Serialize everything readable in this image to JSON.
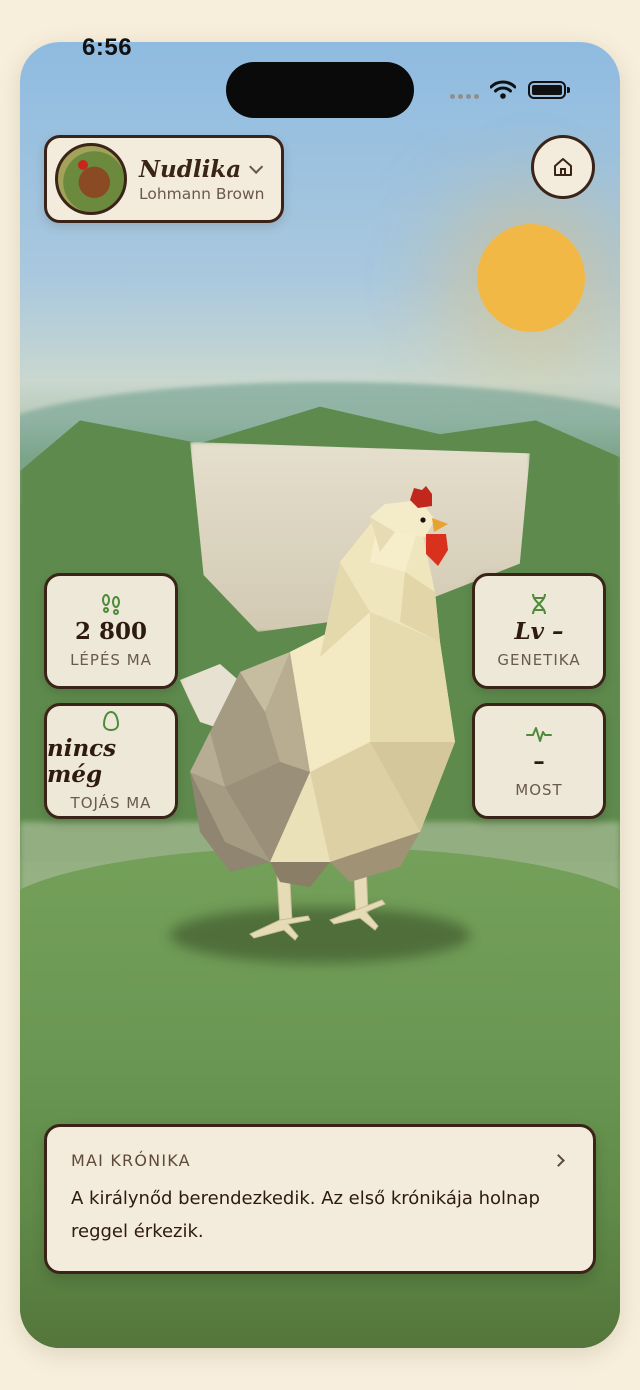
{
  "status_bar": {
    "time": "6:56"
  },
  "profile": {
    "name": "Nudlika",
    "breed": "Lohmann Brown"
  },
  "stats": [
    {
      "icon": "footprints-icon",
      "value": "2 800",
      "label": "LÉPÉS MA"
    },
    {
      "icon": "dna-icon",
      "value": "Lv –",
      "label": "GENETIKA"
    },
    {
      "icon": "egg-icon",
      "value": "nincs még",
      "label": "TOJÁS MA"
    },
    {
      "icon": "pulse-icon",
      "value": "–",
      "label": "MOST"
    }
  ],
  "chronicle": {
    "title": "MAI KRÓNIKA",
    "text": "A királynőd berendezkedik. Az első krónikája holnap reggel érkezik."
  },
  "colors": {
    "accent_green": "#4d8a3a",
    "outline": "#3a2418",
    "card_bg": "#f3ebdc",
    "sun": "#f2b846"
  }
}
